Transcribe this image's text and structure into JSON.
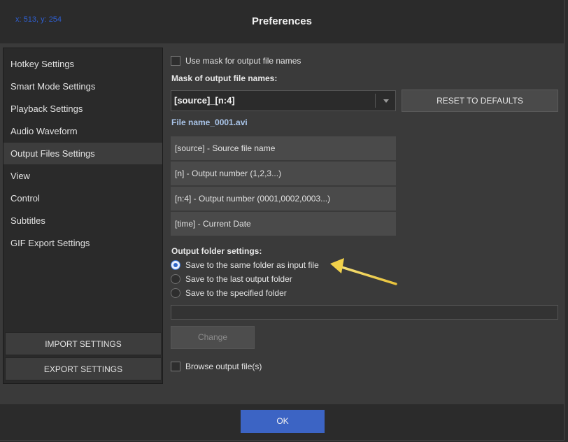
{
  "window": {
    "coord_readout": "x: 513, y: 254",
    "title": "Preferences"
  },
  "sidebar": {
    "items": [
      {
        "label": "Hotkey Settings",
        "active": false
      },
      {
        "label": "Smart Mode Settings",
        "active": false
      },
      {
        "label": "Playback Settings",
        "active": false
      },
      {
        "label": "Audio Waveform",
        "active": false
      },
      {
        "label": "Output Files Settings",
        "active": true
      },
      {
        "label": "View",
        "active": false
      },
      {
        "label": "Control",
        "active": false
      },
      {
        "label": "Subtitles",
        "active": false
      },
      {
        "label": "GIF Export Settings",
        "active": false
      }
    ],
    "import_label": "IMPORT SETTINGS",
    "export_label": "EXPORT SETTINGS"
  },
  "main": {
    "use_mask_label": "Use mask for output file names",
    "use_mask_checked": false,
    "mask_heading": "Mask of output file names:",
    "mask_value": "[source]_[n:4]",
    "reset_label": "RESET TO DEFAULTS",
    "preview": "File name_0001.avi",
    "tokens": [
      "[source] - Source file name",
      "[n] - Output number (1,2,3...)",
      "[n:4] - Output number (0001,0002,0003...)",
      "[time] - Current Date"
    ],
    "folder_heading": "Output folder settings:",
    "folder_options": [
      {
        "label": "Save to the same folder as input file",
        "selected": true
      },
      {
        "label": "Save to the last output folder",
        "selected": false
      },
      {
        "label": "Save to the specified folder",
        "selected": false
      }
    ],
    "folder_path": "",
    "change_label": "Change",
    "browse_label": "Browse output file(s)",
    "browse_checked": false
  },
  "footer": {
    "ok_label": "OK"
  },
  "colors": {
    "accent": "#3c64c4",
    "annotation_arrow": "#f2d24a"
  }
}
